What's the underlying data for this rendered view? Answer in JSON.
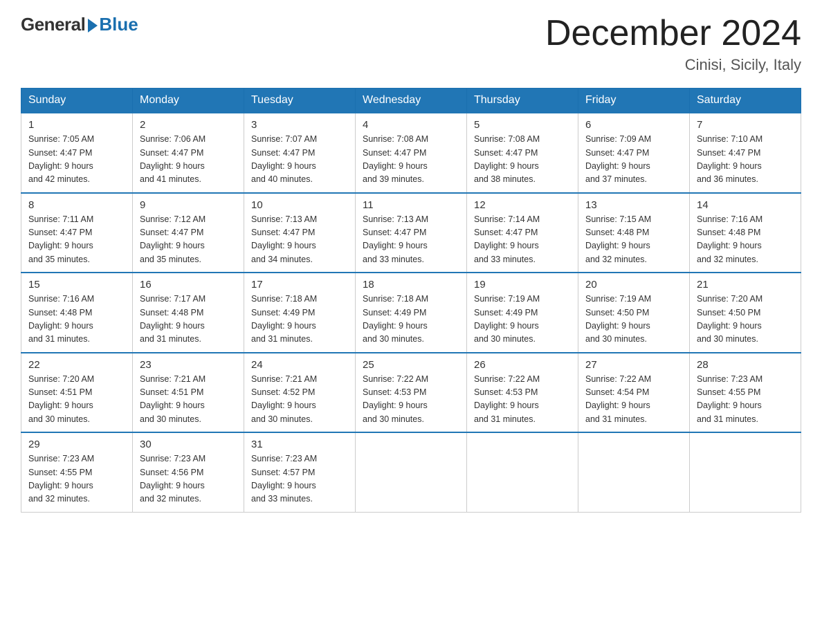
{
  "logo": {
    "general": "General",
    "blue": "Blue"
  },
  "title": "December 2024",
  "location": "Cinisi, Sicily, Italy",
  "days_of_week": [
    "Sunday",
    "Monday",
    "Tuesday",
    "Wednesday",
    "Thursday",
    "Friday",
    "Saturday"
  ],
  "weeks": [
    [
      {
        "day": "1",
        "sunrise": "7:05 AM",
        "sunset": "4:47 PM",
        "daylight": "9 hours and 42 minutes."
      },
      {
        "day": "2",
        "sunrise": "7:06 AM",
        "sunset": "4:47 PM",
        "daylight": "9 hours and 41 minutes."
      },
      {
        "day": "3",
        "sunrise": "7:07 AM",
        "sunset": "4:47 PM",
        "daylight": "9 hours and 40 minutes."
      },
      {
        "day": "4",
        "sunrise": "7:08 AM",
        "sunset": "4:47 PM",
        "daylight": "9 hours and 39 minutes."
      },
      {
        "day": "5",
        "sunrise": "7:08 AM",
        "sunset": "4:47 PM",
        "daylight": "9 hours and 38 minutes."
      },
      {
        "day": "6",
        "sunrise": "7:09 AM",
        "sunset": "4:47 PM",
        "daylight": "9 hours and 37 minutes."
      },
      {
        "day": "7",
        "sunrise": "7:10 AM",
        "sunset": "4:47 PM",
        "daylight": "9 hours and 36 minutes."
      }
    ],
    [
      {
        "day": "8",
        "sunrise": "7:11 AM",
        "sunset": "4:47 PM",
        "daylight": "9 hours and 35 minutes."
      },
      {
        "day": "9",
        "sunrise": "7:12 AM",
        "sunset": "4:47 PM",
        "daylight": "9 hours and 35 minutes."
      },
      {
        "day": "10",
        "sunrise": "7:13 AM",
        "sunset": "4:47 PM",
        "daylight": "9 hours and 34 minutes."
      },
      {
        "day": "11",
        "sunrise": "7:13 AM",
        "sunset": "4:47 PM",
        "daylight": "9 hours and 33 minutes."
      },
      {
        "day": "12",
        "sunrise": "7:14 AM",
        "sunset": "4:47 PM",
        "daylight": "9 hours and 33 minutes."
      },
      {
        "day": "13",
        "sunrise": "7:15 AM",
        "sunset": "4:48 PM",
        "daylight": "9 hours and 32 minutes."
      },
      {
        "day": "14",
        "sunrise": "7:16 AM",
        "sunset": "4:48 PM",
        "daylight": "9 hours and 32 minutes."
      }
    ],
    [
      {
        "day": "15",
        "sunrise": "7:16 AM",
        "sunset": "4:48 PM",
        "daylight": "9 hours and 31 minutes."
      },
      {
        "day": "16",
        "sunrise": "7:17 AM",
        "sunset": "4:48 PM",
        "daylight": "9 hours and 31 minutes."
      },
      {
        "day": "17",
        "sunrise": "7:18 AM",
        "sunset": "4:49 PM",
        "daylight": "9 hours and 31 minutes."
      },
      {
        "day": "18",
        "sunrise": "7:18 AM",
        "sunset": "4:49 PM",
        "daylight": "9 hours and 30 minutes."
      },
      {
        "day": "19",
        "sunrise": "7:19 AM",
        "sunset": "4:49 PM",
        "daylight": "9 hours and 30 minutes."
      },
      {
        "day": "20",
        "sunrise": "7:19 AM",
        "sunset": "4:50 PM",
        "daylight": "9 hours and 30 minutes."
      },
      {
        "day": "21",
        "sunrise": "7:20 AM",
        "sunset": "4:50 PM",
        "daylight": "9 hours and 30 minutes."
      }
    ],
    [
      {
        "day": "22",
        "sunrise": "7:20 AM",
        "sunset": "4:51 PM",
        "daylight": "9 hours and 30 minutes."
      },
      {
        "day": "23",
        "sunrise": "7:21 AM",
        "sunset": "4:51 PM",
        "daylight": "9 hours and 30 minutes."
      },
      {
        "day": "24",
        "sunrise": "7:21 AM",
        "sunset": "4:52 PM",
        "daylight": "9 hours and 30 minutes."
      },
      {
        "day": "25",
        "sunrise": "7:22 AM",
        "sunset": "4:53 PM",
        "daylight": "9 hours and 30 minutes."
      },
      {
        "day": "26",
        "sunrise": "7:22 AM",
        "sunset": "4:53 PM",
        "daylight": "9 hours and 31 minutes."
      },
      {
        "day": "27",
        "sunrise": "7:22 AM",
        "sunset": "4:54 PM",
        "daylight": "9 hours and 31 minutes."
      },
      {
        "day": "28",
        "sunrise": "7:23 AM",
        "sunset": "4:55 PM",
        "daylight": "9 hours and 31 minutes."
      }
    ],
    [
      {
        "day": "29",
        "sunrise": "7:23 AM",
        "sunset": "4:55 PM",
        "daylight": "9 hours and 32 minutes."
      },
      {
        "day": "30",
        "sunrise": "7:23 AM",
        "sunset": "4:56 PM",
        "daylight": "9 hours and 32 minutes."
      },
      {
        "day": "31",
        "sunrise": "7:23 AM",
        "sunset": "4:57 PM",
        "daylight": "9 hours and 33 minutes."
      },
      null,
      null,
      null,
      null
    ]
  ],
  "labels": {
    "sunrise": "Sunrise: ",
    "sunset": "Sunset: ",
    "daylight": "Daylight: "
  }
}
